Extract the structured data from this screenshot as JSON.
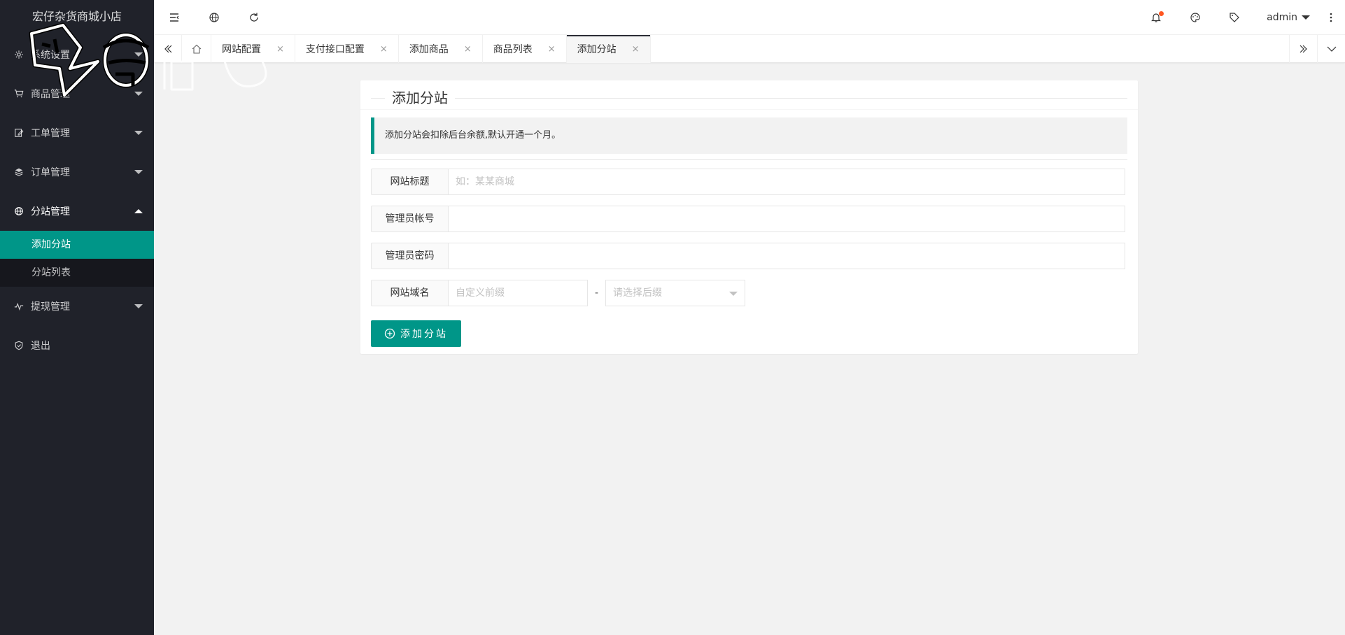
{
  "app": {
    "title": "宏仔杂货商城小店"
  },
  "sidebar": {
    "items": [
      {
        "label": "系统设置",
        "icon": "gear-icon"
      },
      {
        "label": "商品管理",
        "icon": "cart-icon"
      },
      {
        "label": "工单管理",
        "icon": "edit-icon"
      },
      {
        "label": "订单管理",
        "icon": "layers-icon"
      },
      {
        "label": "分站管理",
        "icon": "globe-icon"
      },
      {
        "label": "提现管理",
        "icon": "pulse-icon"
      },
      {
        "label": "退出",
        "icon": "shield-icon"
      }
    ],
    "sub_items": [
      {
        "label": "添加分站",
        "active": true
      },
      {
        "label": "分站列表",
        "active": false
      }
    ]
  },
  "header": {
    "user": "admin",
    "notification_dot_color": "#ff5722"
  },
  "tabs": [
    {
      "label": "网站配置"
    },
    {
      "label": "支付接口配置"
    },
    {
      "label": "添加商品"
    },
    {
      "label": "商品列表"
    },
    {
      "label": "添加分站",
      "active": true
    }
  ],
  "tab_close_glyph": "×",
  "form": {
    "legend": "添加分站",
    "notice": "添加分站会扣除后台余额,默认开通一个月。",
    "fields": {
      "title": {
        "label": "网站标题",
        "placeholder": "如：某某商城",
        "value": ""
      },
      "admin_user": {
        "label": "管理员帐号",
        "placeholder": "",
        "value": ""
      },
      "admin_pass": {
        "label": "管理员密码",
        "placeholder": "",
        "value": ""
      },
      "domain": {
        "label": "网站域名",
        "prefix_placeholder": "自定义前缀",
        "separator": "-",
        "suffix_placeholder": "请选择后缀"
      }
    },
    "submit_label": "添加分站"
  },
  "colors": {
    "accent": "#009688",
    "sidebar_bg": "#20222a",
    "page_bg": "#f2f2f2"
  }
}
